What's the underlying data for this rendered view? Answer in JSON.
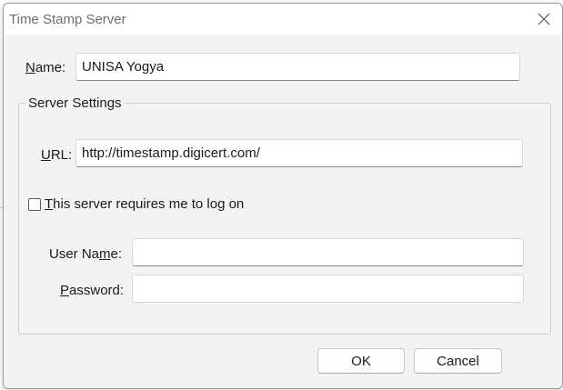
{
  "dialog": {
    "title": "Time Stamp Server",
    "close_icon": "close-icon"
  },
  "name_field": {
    "label_accel": "N",
    "label_rest": "ame:",
    "value": "UNISA Yogya"
  },
  "server_settings": {
    "legend": "Server Settings",
    "url_label_accel": "U",
    "url_label_rest": "RL:",
    "url_value": "http://timestamp.digicert.com/",
    "login_checkbox": {
      "accel": "T",
      "rest": "his server requires me to log on",
      "checked": false
    },
    "username_label_pre": "User Na",
    "username_label_accel": "m",
    "username_label_post": "e:",
    "username_value": "",
    "password_label_accel": "P",
    "password_label_rest": "assword:",
    "password_value": ""
  },
  "buttons": {
    "ok": "OK",
    "cancel": "Cancel"
  }
}
